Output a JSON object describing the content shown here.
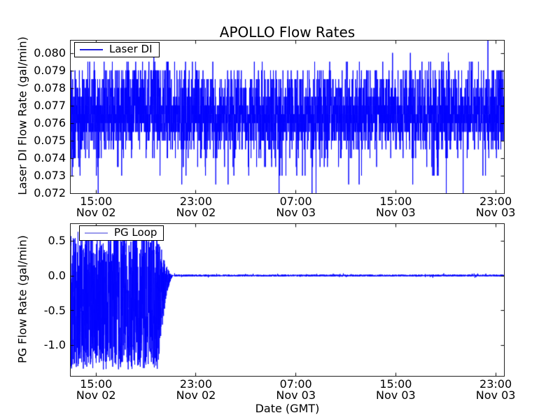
{
  "figure": {
    "title": "APOLLO Flow Rates",
    "background": "#ffffff",
    "axis_color": "#000000"
  },
  "colors": {
    "series_line": "#0000ff",
    "legend_sample_top": "#2222dd",
    "legend_sample_bottom": "#9a9aec",
    "spine": "#222222",
    "text": "#000000"
  },
  "chart_data": [
    {
      "type": "line",
      "title": "APOLLO Flow Rates",
      "ylabel": "Laser DI Flow Rate (gal/min)",
      "legend": {
        "label": "Laser DI",
        "position": "upper left"
      },
      "grid": false,
      "ylim": [
        0.072,
        0.0807
      ],
      "ytick_labels": [
        "0.080",
        "0.079",
        "0.078",
        "0.077",
        "0.076",
        "0.075",
        "0.074",
        "0.073",
        "0.072"
      ],
      "yticks": [
        0.08,
        0.079,
        0.078,
        0.077,
        0.076,
        0.075,
        0.074,
        0.073,
        0.072
      ],
      "xlim_hours": [
        0,
        34.7
      ],
      "xticks_hours": [
        2,
        10,
        18,
        26,
        34
      ],
      "xtick_labels": [
        {
          "time": "15:00",
          "date": "Nov 02"
        },
        {
          "time": "23:00",
          "date": "Nov 02"
        },
        {
          "time": "07:00",
          "date": "Nov 03"
        },
        {
          "time": "15:00",
          "date": "Nov 03"
        },
        {
          "time": "23:00",
          "date": "Nov 03"
        }
      ],
      "series": [
        {
          "name": "Laser DI",
          "color": "#0000ff",
          "n_points": 3800,
          "description": "dense noisy flow signal quantized in 0.0005 gal/min steps; solid band 0.0755-0.077, frequent spikes to 0.079, rare spikes to 0.080, dips to 0.073-0.072, one clipped spike above 0.080",
          "levels": [
            0.08,
            0.0795,
            0.079,
            0.0785,
            0.078,
            0.0775,
            0.077,
            0.0765,
            0.076,
            0.0755,
            0.075,
            0.0745,
            0.074,
            0.0735,
            0.073,
            0.0725,
            0.072
          ],
          "weights": [
            0.002,
            0.008,
            0.045,
            0.05,
            0.06,
            0.07,
            0.13,
            0.19,
            0.2,
            0.12,
            0.06,
            0.035,
            0.015,
            0.008,
            0.006,
            0.002,
            0.001
          ],
          "clipped_spike_x_fraction": 0.963,
          "clipped_spike_value": 0.0815
        }
      ]
    },
    {
      "type": "line",
      "ylabel": "PG Flow Rate (gal/min)",
      "xlabel": "Date (GMT)",
      "legend": {
        "label": "PG Loop",
        "position": "upper left"
      },
      "grid": false,
      "ylim": [
        -1.44,
        0.74
      ],
      "ytick_labels": [
        "0.5",
        "0.0",
        "-0.5",
        "-1.0"
      ],
      "yticks": [
        0.5,
        0.0,
        -0.5,
        -1.0
      ],
      "xlim_hours": [
        0,
        34.7
      ],
      "xticks_hours": [
        2,
        10,
        18,
        26,
        34
      ],
      "xtick_labels": [
        {
          "time": "15:00",
          "date": "Nov 02"
        },
        {
          "time": "23:00",
          "date": "Nov 02"
        },
        {
          "time": "07:00",
          "date": "Nov 03"
        },
        {
          "time": "15:00",
          "date": "Nov 03"
        },
        {
          "time": "23:00",
          "date": "Nov 03"
        }
      ],
      "series": [
        {
          "name": "PG Loop",
          "color": "#0000ff",
          "n_points": 4200,
          "description": "large oscillating noise between -1.35 and +0.63 gal/min from start (~13:00 Nov 02) until ~21:15 Nov 02, amplitude tapers, then flat at 0.0 for remainder",
          "noise_upper": 0.63,
          "noise_lower": -1.35,
          "taper_start_hour": 7.0,
          "noise_end_hour": 8.3,
          "flat_value": 0.0
        }
      ]
    }
  ]
}
